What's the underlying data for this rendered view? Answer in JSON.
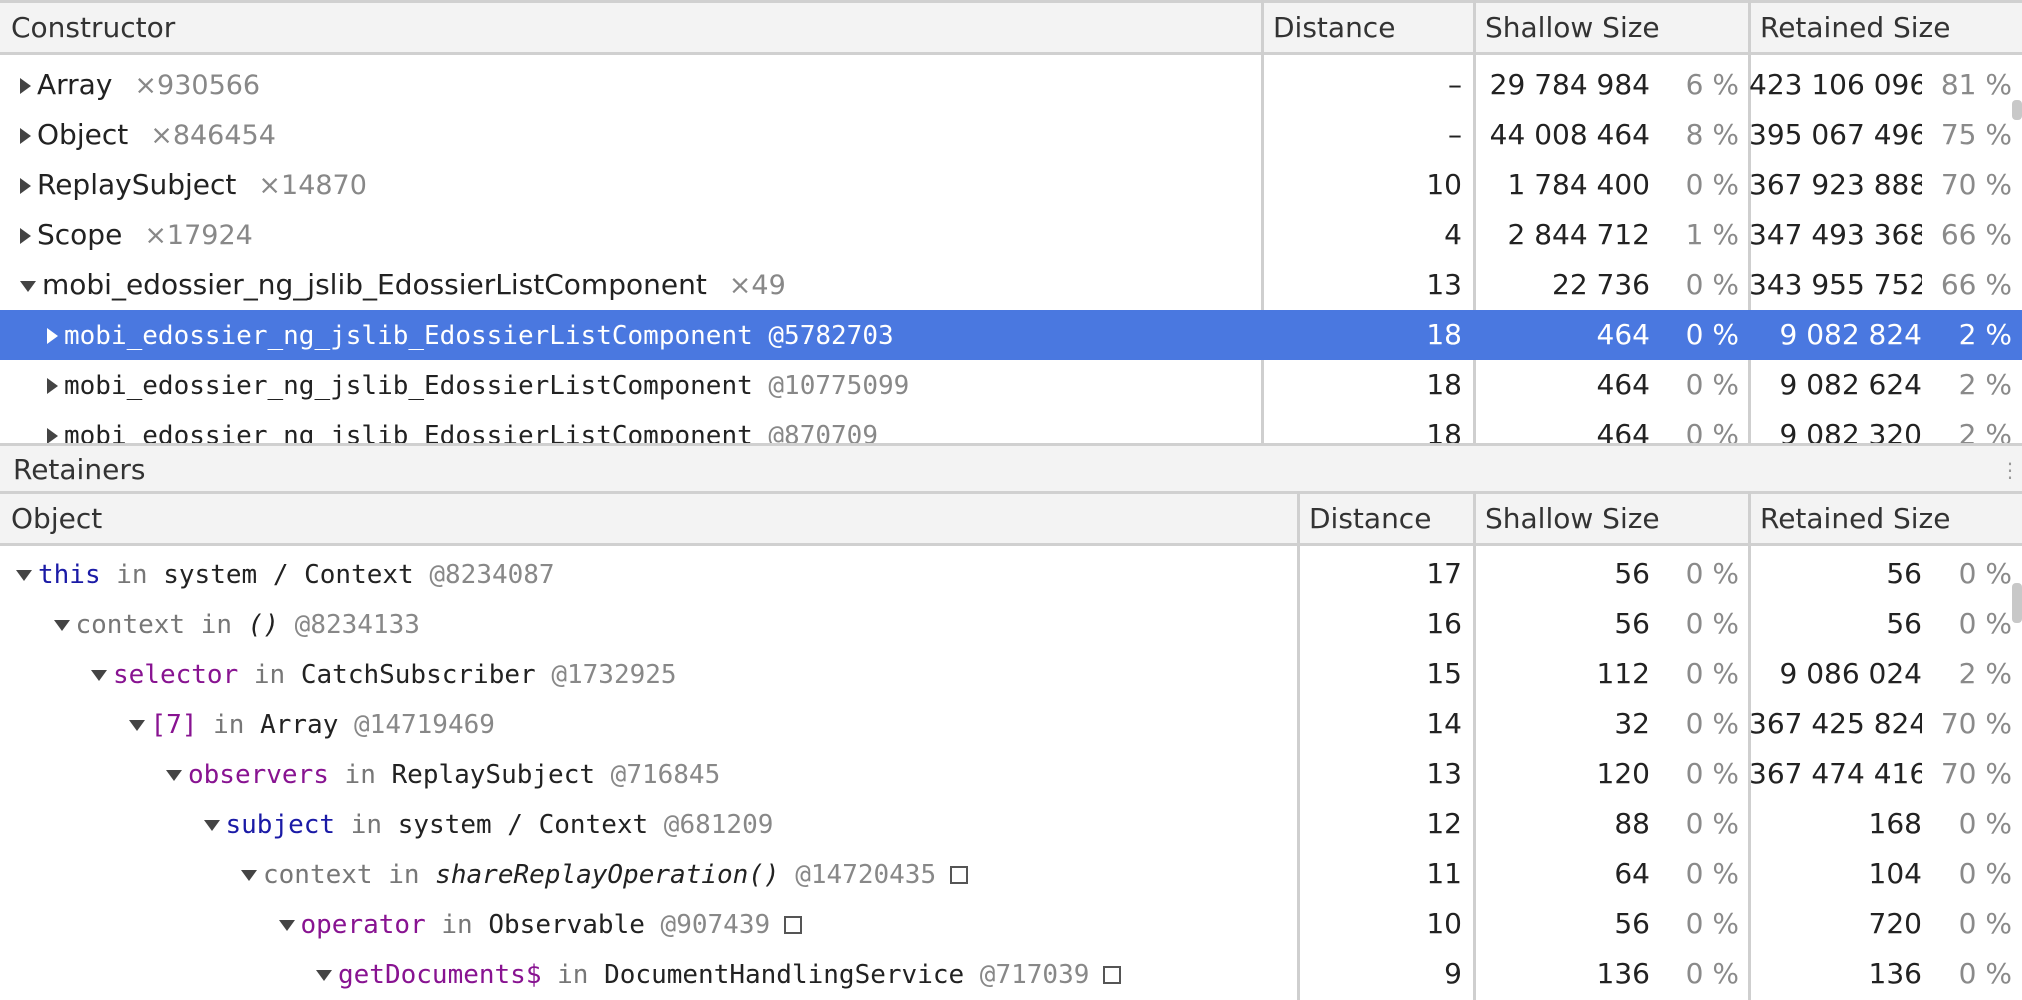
{
  "constructor_table": {
    "headers": {
      "name": "Constructor",
      "distance": "Distance",
      "shallow": "Shallow Size",
      "retained": "Retained Size"
    },
    "rows": [
      {
        "expand": "right",
        "indent": 0,
        "name": "Array",
        "count": "×930566",
        "distance": "–",
        "shallow": "29 784 984",
        "shallow_pct": "6 %",
        "retained": "423 106 096",
        "retained_pct": "81 %"
      },
      {
        "expand": "right",
        "indent": 0,
        "name": "Object",
        "count": "×846454",
        "distance": "–",
        "shallow": "44 008 464",
        "shallow_pct": "8 %",
        "retained": "395 067 496",
        "retained_pct": "75 %"
      },
      {
        "expand": "right",
        "indent": 0,
        "name": "ReplaySubject",
        "count": "×14870",
        "distance": "10",
        "shallow": "1 784 400",
        "shallow_pct": "0 %",
        "retained": "367 923 888",
        "retained_pct": "70 %"
      },
      {
        "expand": "right",
        "indent": 0,
        "name": "Scope",
        "count": "×17924",
        "distance": "4",
        "shallow": "2 844 712",
        "shallow_pct": "1 %",
        "retained": "347 493 368",
        "retained_pct": "66 %"
      },
      {
        "expand": "down",
        "indent": 0,
        "name": "mobi_edossier_ng_jslib_EdossierListComponent",
        "count": "×49",
        "distance": "13",
        "shallow": "22 736",
        "shallow_pct": "0 %",
        "retained": "343 955 752",
        "retained_pct": "66 %"
      },
      {
        "expand": "right",
        "indent": 1,
        "mono": true,
        "selected": true,
        "name": "mobi_edossier_ng_jslib_EdossierListComponent",
        "objid": "@5782703",
        "distance": "18",
        "shallow": "464",
        "shallow_pct": "0 %",
        "retained": "9 082 824",
        "retained_pct": "2 %"
      },
      {
        "expand": "right",
        "indent": 1,
        "mono": true,
        "name": "mobi_edossier_ng_jslib_EdossierListComponent",
        "objid": "@10775099",
        "distance": "18",
        "shallow": "464",
        "shallow_pct": "0 %",
        "retained": "9 082 624",
        "retained_pct": "2 %"
      },
      {
        "expand": "right",
        "indent": 1,
        "mono": true,
        "name": "mobi_edossier_ng_jslib_EdossierListComponent",
        "objid": "@870709",
        "distance": "18",
        "shallow": "464",
        "shallow_pct": "0 %",
        "retained": "9 082 320",
        "retained_pct": "2 %"
      }
    ]
  },
  "retainers": {
    "title": "Retainers",
    "headers": {
      "name": "Object",
      "distance": "Distance",
      "shallow": "Shallow Size",
      "retained": "Retained Size"
    },
    "rows": [
      {
        "indent": 0,
        "prop": "this",
        "prop_color": "blue",
        "in": "in",
        "owner": "system / Context",
        "objid": "@8234087",
        "box": false,
        "distance": "17",
        "shallow": "56",
        "shallow_pct": "0 %",
        "retained": "56",
        "retained_pct": "0 %"
      },
      {
        "indent": 1,
        "prop": "context",
        "prop_color": "gray",
        "in": "in",
        "owner": "()",
        "owner_italic": true,
        "objid": "@8234133",
        "box": false,
        "distance": "16",
        "shallow": "56",
        "shallow_pct": "0 %",
        "retained": "56",
        "retained_pct": "0 %"
      },
      {
        "indent": 2,
        "prop": "selector",
        "prop_color": "purple",
        "in": "in",
        "owner": "CatchSubscriber",
        "objid": "@1732925",
        "box": false,
        "distance": "15",
        "shallow": "112",
        "shallow_pct": "0 %",
        "retained": "9 086 024",
        "retained_pct": "2 %"
      },
      {
        "indent": 3,
        "prop": "[7]",
        "prop_color": "purple",
        "in": "in",
        "owner": "Array",
        "objid": "@14719469",
        "box": false,
        "distance": "14",
        "shallow": "32",
        "shallow_pct": "0 %",
        "retained": "367 425 824",
        "retained_pct": "70 %"
      },
      {
        "indent": 4,
        "prop": "observers",
        "prop_color": "purple",
        "in": "in",
        "owner": "ReplaySubject",
        "objid": "@716845",
        "box": false,
        "distance": "13",
        "shallow": "120",
        "shallow_pct": "0 %",
        "retained": "367 474 416",
        "retained_pct": "70 %"
      },
      {
        "indent": 5,
        "prop": "subject",
        "prop_color": "blue",
        "in": "in",
        "owner": "system / Context",
        "objid": "@681209",
        "box": false,
        "distance": "12",
        "shallow": "88",
        "shallow_pct": "0 %",
        "retained": "168",
        "retained_pct": "0 %"
      },
      {
        "indent": 6,
        "prop": "context",
        "prop_color": "gray",
        "in": "in",
        "owner": "shareReplayOperation()",
        "owner_italic": true,
        "objid": "@14720435",
        "box": true,
        "distance": "11",
        "shallow": "64",
        "shallow_pct": "0 %",
        "retained": "104",
        "retained_pct": "0 %"
      },
      {
        "indent": 7,
        "prop": "operator",
        "prop_color": "purple",
        "in": "in",
        "owner": "Observable",
        "objid": "@907439",
        "box": true,
        "distance": "10",
        "shallow": "56",
        "shallow_pct": "0 %",
        "retained": "720",
        "retained_pct": "0 %"
      },
      {
        "indent": 8,
        "prop": "getDocuments$",
        "prop_color": "purple",
        "in": "in",
        "owner": "DocumentHandlingService",
        "objid": "@717039",
        "box": true,
        "distance": "9",
        "shallow": "136",
        "shallow_pct": "0 %",
        "retained": "136",
        "retained_pct": "0 %"
      }
    ]
  }
}
